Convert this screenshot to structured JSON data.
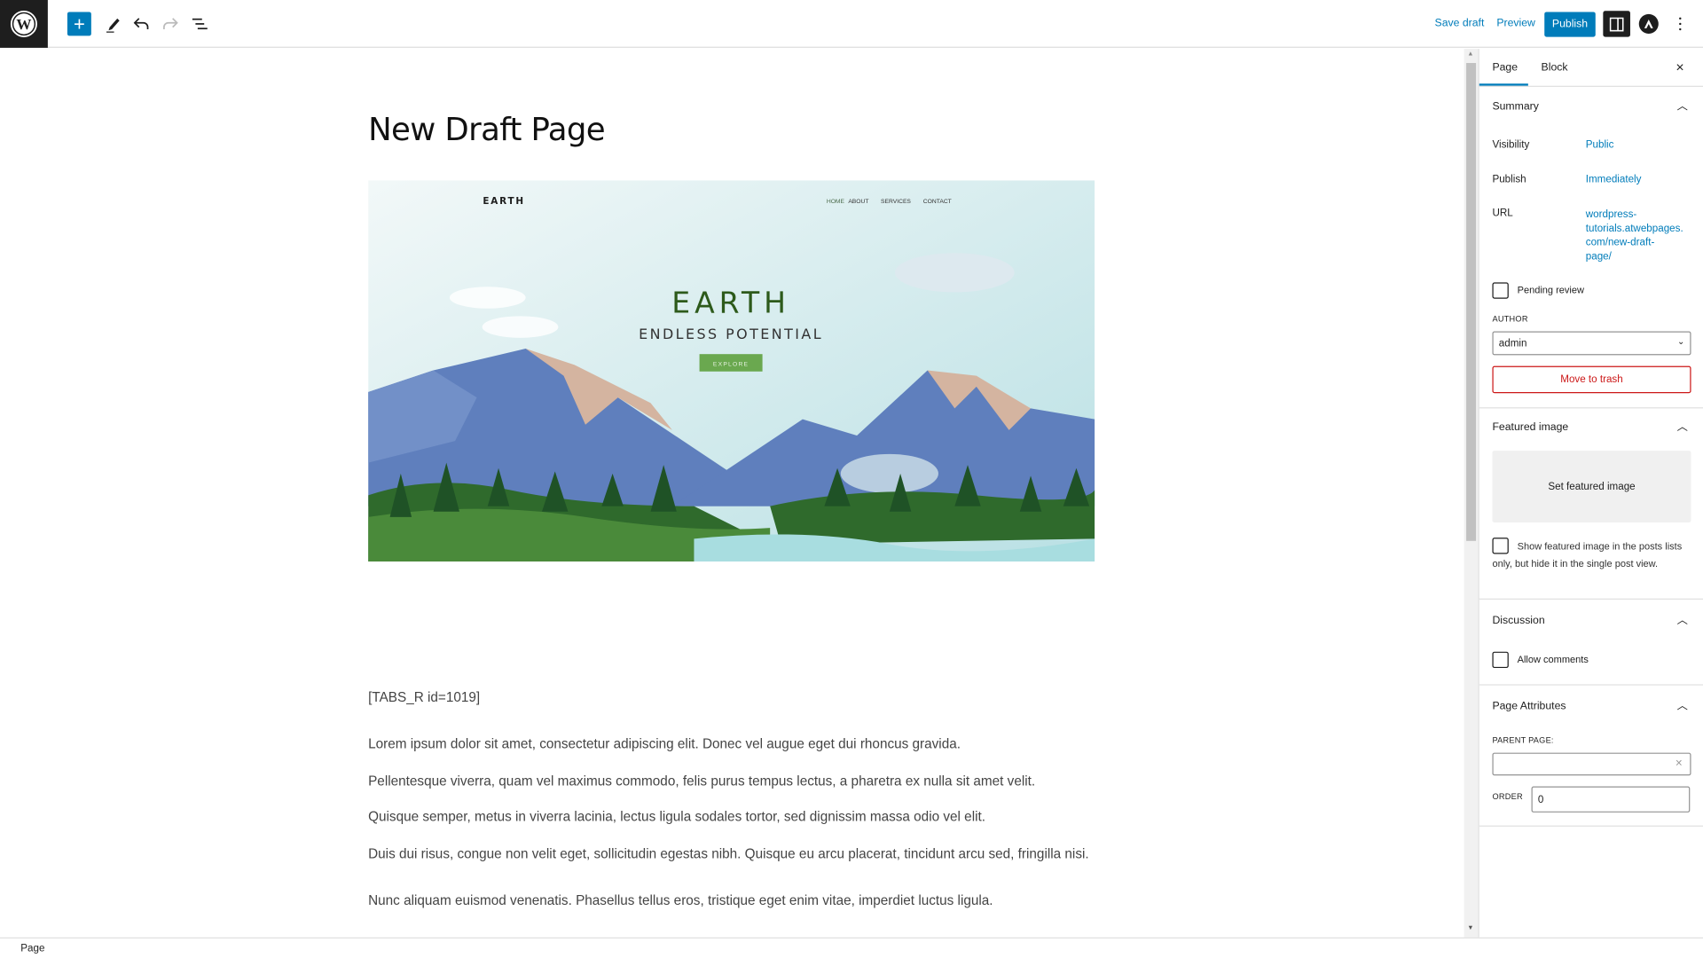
{
  "toolbar": {
    "save_draft": "Save draft",
    "preview": "Preview",
    "publish": "Publish",
    "icons": [
      "wordpress-logo",
      "add-block-icon",
      "edit-tools-icon",
      "undo-icon",
      "redo-icon",
      "document-overview-icon",
      "settings-toggle-icon",
      "astra-icon",
      "options-icon"
    ]
  },
  "editor": {
    "title": "New Draft Page",
    "hero": {
      "logo": "EARTH",
      "nav": [
        "HOME",
        "ABOUT",
        "SERVICES",
        "CONTACT"
      ],
      "heading": "EARTH",
      "subheading": "ENDLESS POTENTIAL",
      "button": "EXPLORE"
    },
    "shortcode": "[TABS_R id=1019]",
    "paragraphs": [
      "Lorem ipsum dolor sit amet, consectetur adipiscing elit. Donec vel augue eget dui rhoncus gravida.",
      "Pellentesque viverra, quam vel maximus commodo, felis purus tempus lectus, a pharetra ex nulla sit amet velit.",
      "Quisque semper, metus in viverra lacinia, lectus ligula sodales tortor, sed dignissim massa odio vel elit.",
      "Duis dui risus, congue non velit eget, sollicitudin egestas nibh. Quisque eu arcu placerat, tincidunt arcu sed, fringilla nisi.",
      "Nunc aliquam euismod venenatis. Phasellus tellus eros, tristique eget enim vitae, imperdiet luctus ligula."
    ]
  },
  "sidebar": {
    "tabs": [
      "Page",
      "Block"
    ],
    "active_tab": "Page",
    "summary": {
      "title": "Summary",
      "visibility_label": "Visibility",
      "visibility_value": "Public",
      "publish_label": "Publish",
      "publish_value": "Immediately",
      "url_label": "URL",
      "url_lines": [
        "wordpress-",
        "tutorials.atwebpages.",
        "com/new-draft-",
        "page/"
      ],
      "pending_review": "Pending review",
      "author_label": "AUTHOR",
      "author_value": "admin",
      "trash": "Move to trash"
    },
    "featured": {
      "title": "Featured image",
      "set": "Set featured image",
      "checkbox": "Show featured image in the posts lists only, but hide it in the single post view."
    },
    "discussion": {
      "title": "Discussion",
      "allow_comments": "Allow comments"
    },
    "attributes": {
      "title": "Page Attributes",
      "parent_label": "PARENT PAGE:",
      "parent_value": "",
      "order_label": "ORDER",
      "order_value": "0"
    }
  },
  "footer": {
    "breadcrumb": "Page"
  },
  "colors": {
    "accent": "#007cba",
    "danger": "#cc1818",
    "dark": "#1e1e1e",
    "hero_green": "#2d5a1b",
    "explore": "#6aa84f"
  }
}
